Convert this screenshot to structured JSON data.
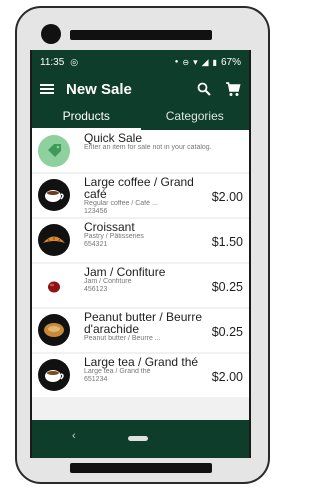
{
  "status_bar": {
    "time": "11:35",
    "battery": "67%"
  },
  "toolbar": {
    "title": "New Sale"
  },
  "tabs": [
    {
      "label": "Products",
      "active": true
    },
    {
      "label": "Categories",
      "active": false
    }
  ],
  "quick_sale": {
    "title": "Quick Sale",
    "description": "Enter an item for sale not in your catalog."
  },
  "products": [
    {
      "name": "Large coffee / Grand café",
      "sub": "Regular coffee / Café ...",
      "sku": "123456",
      "price": "$2.00",
      "icon": "coffee-cup-icon"
    },
    {
      "name": "Croissant",
      "sub": "Pastry / Pâtisseries",
      "sku": "654321",
      "price": "$1.50",
      "icon": "croissant-icon"
    },
    {
      "name": "Jam / Confiture",
      "sub": "Jam / Confiture",
      "sku": "456123",
      "price": "$0.25",
      "icon": "jam-icon"
    },
    {
      "name": "Peanut butter / Beurre d'arachide",
      "sub": "Peanut butter / Beurre ...",
      "sku": "",
      "price": "$0.25",
      "icon": "peanut-butter-icon"
    },
    {
      "name": "Large tea / Grand thé",
      "sub": "Large tea / Grand thé",
      "sku": "651234",
      "price": "$2.00",
      "icon": "tea-cup-icon"
    }
  ],
  "colors": {
    "primary": "#0f3d2b",
    "quick_sale": "#8fd19e"
  }
}
